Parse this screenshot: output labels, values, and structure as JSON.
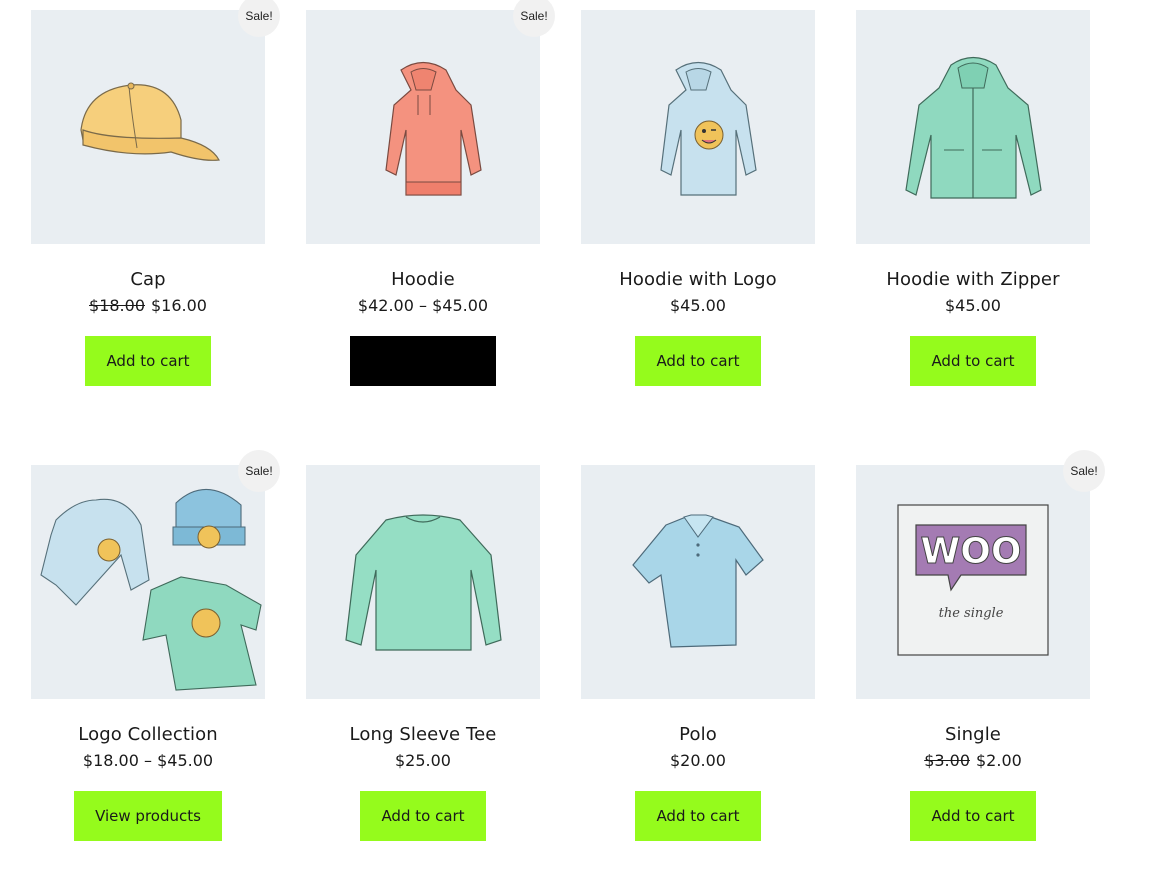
{
  "products": [
    {
      "name": "Cap",
      "old_price": "$18.00",
      "price": "$16.00",
      "sale": "Sale!",
      "button": "Add to cart"
    },
    {
      "name": "Hoodie",
      "old_price": "",
      "price": "$42.00 – $45.00",
      "sale": "Sale!",
      "button": ""
    },
    {
      "name": "Hoodie with Logo",
      "old_price": "",
      "price": "$45.00",
      "sale": "",
      "button": "Add to cart"
    },
    {
      "name": "Hoodie with Zipper",
      "old_price": "",
      "price": "$45.00",
      "sale": "",
      "button": "Add to cart"
    },
    {
      "name": "Logo Collection",
      "old_price": "",
      "price": "$18.00 – $45.00",
      "sale": "Sale!",
      "button": "View products"
    },
    {
      "name": "Long Sleeve Tee",
      "old_price": "",
      "price": "$25.00",
      "sale": "",
      "button": "Add to cart"
    },
    {
      "name": "Polo",
      "old_price": "",
      "price": "$20.00",
      "sale": "",
      "button": "Add to cart"
    },
    {
      "name": "Single",
      "old_price": "$3.00",
      "price": "$2.00",
      "sale": "Sale!",
      "button": "Add to cart"
    }
  ],
  "logo_text": "WOO",
  "logo_subtext": "the single",
  "colors": {
    "button": "#95fb1c",
    "image_bg": "#e9eef2",
    "sale_badge": "#f1f1f1",
    "hoodie_select_button": "#000000"
  }
}
